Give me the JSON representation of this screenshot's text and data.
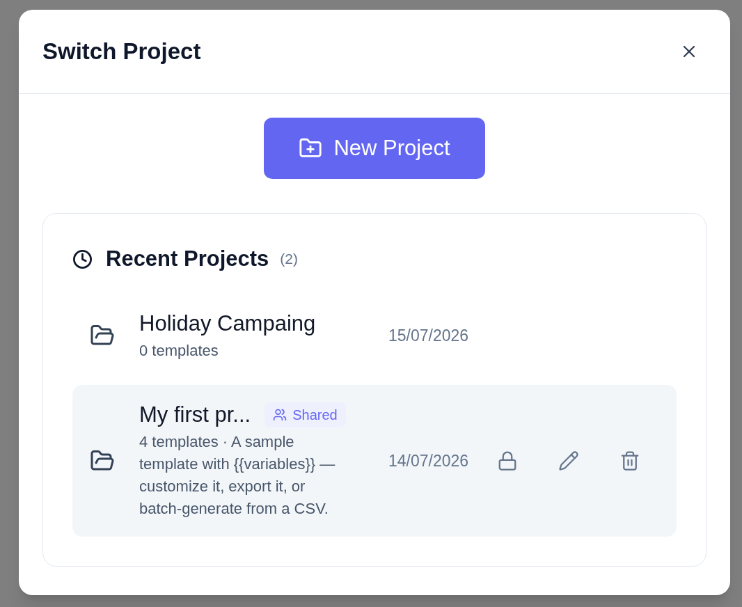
{
  "dialog": {
    "title": "Switch Project"
  },
  "new_project_button": {
    "label": "New Project"
  },
  "recent_projects": {
    "title": "Recent Projects",
    "count": "(2)",
    "projects": [
      {
        "name": "Holiday Campaing",
        "subtitle": "0 templates",
        "date": "15/07/2026",
        "selected": false
      },
      {
        "name": "My first pr...",
        "badge": "Shared",
        "subtitle": "4 templates · A sample template with {{variables}} — customize it, export it, or batch-generate from a CSV.",
        "date": "14/07/2026",
        "selected": true,
        "actions": [
          {
            "kind": "lock"
          },
          {
            "kind": "edit"
          },
          {
            "kind": "delete"
          }
        ]
      }
    ]
  }
}
